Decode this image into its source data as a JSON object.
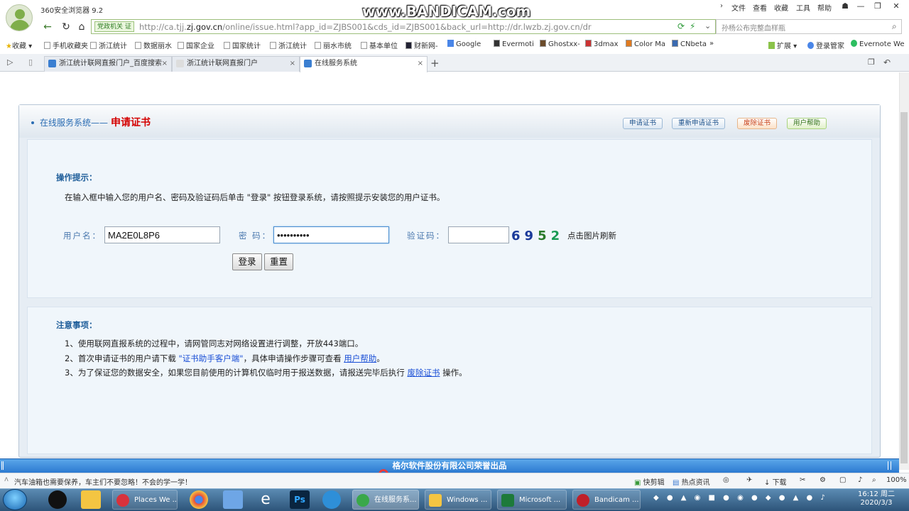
{
  "browser": {
    "title": "360安全浏览器 9.2",
    "menu": [
      "文件",
      "查看",
      "收藏",
      "工具",
      "帮助"
    ],
    "watermark": "www.BANDICAM.com"
  },
  "address_bar": {
    "gov_badge": "党政机关 证",
    "url_prefix": "http://ca.tjj.",
    "url_domain": "zj.gov.cn",
    "url_suffix": "/online/issue.html?app_id=ZJBS001&cds_id=ZJBS001&back_url=http://dr.lwzb.zj.gov.cn/dr",
    "search_placeholder": "孙杨公布完整血样瓶"
  },
  "bookmarks": {
    "left": [
      "收藏",
      "手机收藏夹",
      "浙江统计",
      "数据丽水",
      "国家企业",
      "国家统计",
      "浙江统计",
      "丽水市统",
      "基本单位",
      "财新网-",
      "Google",
      "Evermoti",
      "Ghostxx-",
      "3dmax",
      "Color Ma",
      "CNbeta"
    ],
    "right": [
      "扩展",
      "登录管家",
      "Evernote We"
    ]
  },
  "tabs": [
    {
      "label": "浙江统计联网直报门户_百度搜索"
    },
    {
      "label": "浙江统计联网直报门户"
    },
    {
      "label": "在线服务系统"
    }
  ],
  "page": {
    "header_caption": "在线服务系统——",
    "header_title": "申请证书",
    "header_buttons": [
      "申请证书",
      "重新申请证书",
      "废除证书",
      "用户帮助"
    ],
    "hint_title": "操作提示：",
    "hint_text": "在输入框中输入您的用户名、密码及验证码后单击 \"登录\" 按钮登录系统，请按照提示安装您的用户证书。",
    "form": {
      "username_label": "用户名：",
      "username_value": "MA2E0L8P6",
      "password_label": "密 码：",
      "password_value": "••••••••••",
      "captcha_label": "验证码：",
      "captcha_value": "",
      "captcha_digits": [
        "6",
        "9",
        "5",
        "2"
      ],
      "refresh_text": "点击图片刷新",
      "login_button": "登录",
      "reset_button": "重置"
    },
    "notes_title": "注意事项：",
    "notes": {
      "n1": "1、使用联网直报系统的过程中，请网管同志对网络设置进行调整，开放443端口。",
      "n2_pre": "2、首次申请证书的用户请下载 ",
      "n2_q1": "\"证书助手客户端\"",
      "n2_mid": "，具体申请操作步骤可查看 ",
      "n2_link": "用户帮助",
      "n2_post": "。",
      "n3_pre": "3、为了保证您的数据安全，如果您目前使用的计算机仅临时用于报送数据，请报送完毕后执行 ",
      "n3_link": "废除证书",
      "n3_post": " 操作。"
    },
    "footer": "格尔软件股份有限公司荣誉出品"
  },
  "statusbar": {
    "left": "汽车油箱也需要保养，车主们不要忽略！不会的学一学！",
    "items": [
      "快剪辑",
      "热点资讯",
      "下载",
      "100%"
    ]
  },
  "taskbar": {
    "apps": [
      "Places We ...",
      "在线服务系...",
      "Windows ...",
      "Microsoft ...",
      "Bandicam ..."
    ],
    "time": "16:12 周二",
    "date": "2020/3/3"
  },
  "colors": {
    "accent_blue": "#2a6cb3",
    "title_red": "#d40000",
    "footer_blue": "#2c7ad1",
    "link_blue": "#1a4fd6"
  }
}
